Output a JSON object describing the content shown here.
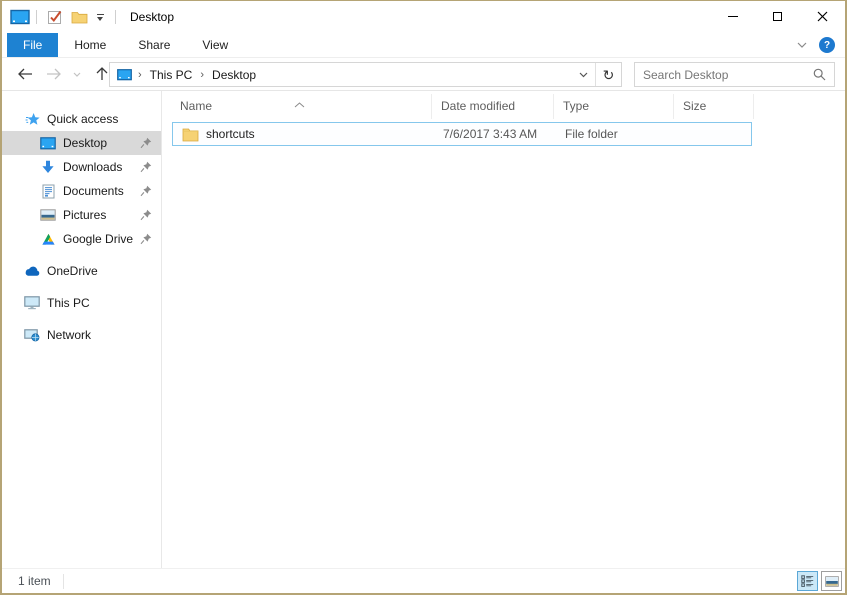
{
  "titlebar": {
    "title": "Desktop",
    "qat": {
      "properties_tooltip": "Properties",
      "new_folder_tooltip": "New folder",
      "customize_tooltip": "Customize Quick Access Toolbar"
    }
  },
  "ribbon": {
    "tabs": [
      {
        "label": "File",
        "active": true
      },
      {
        "label": "Home",
        "active": false
      },
      {
        "label": "Share",
        "active": false
      },
      {
        "label": "View",
        "active": false
      }
    ]
  },
  "address_bar": {
    "breadcrumb": [
      "This PC",
      "Desktop"
    ],
    "refresh_glyph": "↻",
    "search_placeholder": "Search Desktop"
  },
  "sidebar": {
    "items": [
      {
        "label": "Quick access",
        "icon": "quick-access-star-icon",
        "level": "top",
        "pinned": false,
        "selected": false
      },
      {
        "label": "Desktop",
        "icon": "monitor-icon",
        "level": "child",
        "pinned": true,
        "selected": true
      },
      {
        "label": "Downloads",
        "icon": "download-arrow-icon",
        "level": "child",
        "pinned": true,
        "selected": false
      },
      {
        "label": "Documents",
        "icon": "document-icon",
        "level": "child",
        "pinned": true,
        "selected": false
      },
      {
        "label": "Pictures",
        "icon": "picture-icon",
        "level": "child",
        "pinned": true,
        "selected": false
      },
      {
        "label": "Google Drive",
        "icon": "google-drive-icon",
        "level": "child",
        "pinned": true,
        "selected": false
      },
      {
        "label": "OneDrive",
        "icon": "onedrive-cloud-icon",
        "level": "top",
        "pinned": false,
        "selected": false
      },
      {
        "label": "This PC",
        "icon": "this-pc-monitor-icon",
        "level": "top",
        "pinned": false,
        "selected": false
      },
      {
        "label": "Network",
        "icon": "network-icon",
        "level": "top",
        "pinned": false,
        "selected": false
      }
    ]
  },
  "file_list": {
    "columns": [
      "Name",
      "Date modified",
      "Type",
      "Size"
    ],
    "sort": {
      "column": "Name",
      "direction": "ascending"
    },
    "rows": [
      {
        "name": "shortcuts",
        "date_modified": "7/6/2017 3:43 AM",
        "type": "File folder",
        "size": "",
        "selected": true
      }
    ]
  },
  "status_bar": {
    "items_text": "1 item",
    "view_toggles": [
      "details-view",
      "large-thumbnails-view"
    ]
  },
  "colors": {
    "accent_blue": "#1e82d2",
    "selection_border": "#85c7ec",
    "sidebar_selected": "#d9d9d9",
    "window_border": "#b5a475",
    "help_blue": "#1d79cf",
    "folder_yellow": "#f6d274"
  }
}
